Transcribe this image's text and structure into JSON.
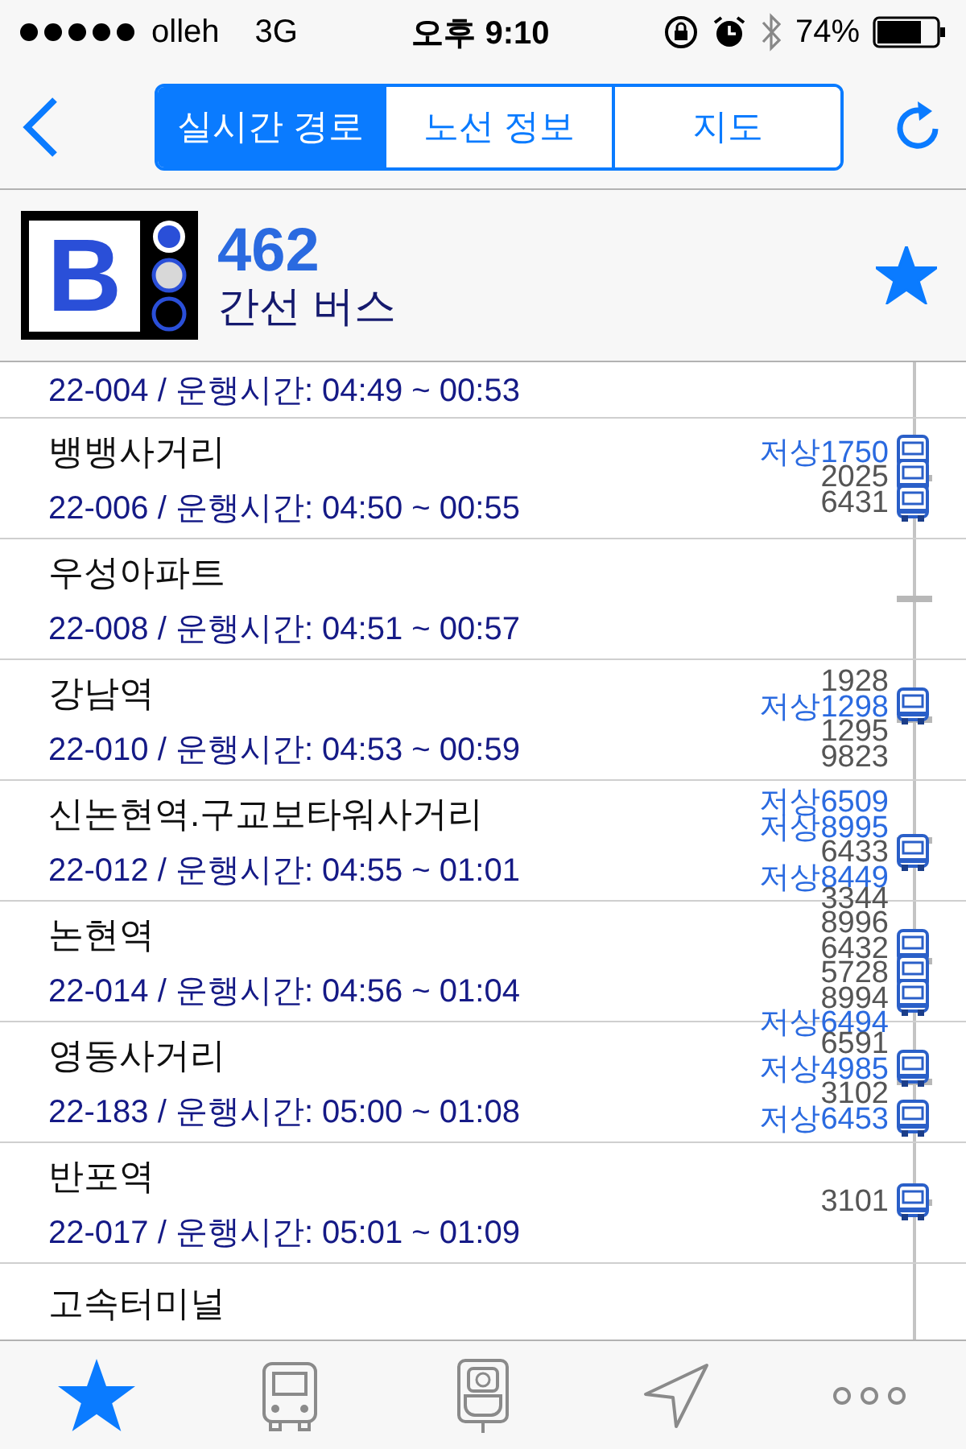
{
  "status_bar": {
    "carrier": "olleh",
    "network": "3G",
    "time": "오후 9:10",
    "battery": "74%"
  },
  "nav": {
    "tabs": [
      {
        "label": "실시간 경로",
        "selected": true
      },
      {
        "label": "노선 정보",
        "selected": false
      },
      {
        "label": "지도",
        "selected": false
      }
    ]
  },
  "route": {
    "logo_letter": "B",
    "number": "462",
    "type": "간선 버스",
    "favorite": true
  },
  "stops": [
    {
      "id_hours": "22-004 / 운행시간: 04:49 ~ 00:53"
    },
    {
      "name": "뱅뱅사거리",
      "id_hours": "22-006 / 운행시간: 04:50 ~ 00:55",
      "buses": [
        {
          "label": "저상1750",
          "low_floor": true,
          "bus_icon": true
        },
        {
          "label": "2025",
          "low_floor": false,
          "bus_icon": true
        },
        {
          "label": "6431",
          "low_floor": false,
          "bus_icon": true
        }
      ]
    },
    {
      "name": "우성아파트",
      "id_hours": "22-008 / 운행시간: 04:51 ~ 00:57"
    },
    {
      "name": "강남역",
      "id_hours": "22-010 / 운행시간: 04:53 ~ 00:59",
      "buses": [
        {
          "label": "1928",
          "low_floor": false,
          "bus_icon": false
        },
        {
          "label": "저상1298",
          "low_floor": true,
          "bus_icon": true
        },
        {
          "label": "1295",
          "low_floor": false,
          "bus_icon": false
        },
        {
          "label": "9823",
          "low_floor": false,
          "bus_icon": false
        }
      ]
    },
    {
      "name": "신논현역.구교보타워사거리",
      "id_hours": "22-012 / 운행시간: 04:55 ~ 01:01",
      "buses": [
        {
          "label": "저상6509",
          "low_floor": true,
          "bus_icon": false
        },
        {
          "label": "저상8995",
          "low_floor": true,
          "bus_icon": false
        },
        {
          "label": "6433",
          "low_floor": false,
          "bus_icon": true
        },
        {
          "label": "저상8449",
          "low_floor": true,
          "bus_icon": false
        }
      ]
    },
    {
      "name": "논현역",
      "id_hours": "22-014 / 운행시간: 04:56 ~ 01:04",
      "buses": [
        {
          "label": "3344",
          "low_floor": false,
          "bus_icon": false
        },
        {
          "label": "8996",
          "low_floor": false,
          "bus_icon": false
        },
        {
          "label": "6432",
          "low_floor": false,
          "bus_icon": true
        },
        {
          "label": "5728",
          "low_floor": false,
          "bus_icon": true
        },
        {
          "label": "8994",
          "low_floor": false,
          "bus_icon": true
        },
        {
          "label": "저상6494",
          "low_floor": true,
          "bus_icon": false
        }
      ]
    },
    {
      "name": "영동사거리",
      "id_hours": "22-183 / 운행시간: 05:00 ~ 01:08",
      "buses": [
        {
          "label": "6591",
          "low_floor": false,
          "bus_icon": false
        },
        {
          "label": "저상4985",
          "low_floor": true,
          "bus_icon": true
        },
        {
          "label": "3102",
          "low_floor": false,
          "bus_icon": false
        },
        {
          "label": "저상6453",
          "low_floor": true,
          "bus_icon": true
        }
      ]
    },
    {
      "name": "반포역",
      "id_hours": "22-017 / 운행시간: 05:01 ~ 01:09",
      "buses": [
        {
          "label": "3101",
          "low_floor": false,
          "bus_icon": true
        }
      ]
    },
    {
      "name": "고속터미널"
    }
  ],
  "tab_bar": [
    {
      "kind": "favorites",
      "selected": true
    },
    {
      "kind": "bus",
      "selected": false
    },
    {
      "kind": "stop",
      "selected": false
    },
    {
      "kind": "nearby",
      "selected": false
    },
    {
      "kind": "more",
      "selected": false
    }
  ]
}
